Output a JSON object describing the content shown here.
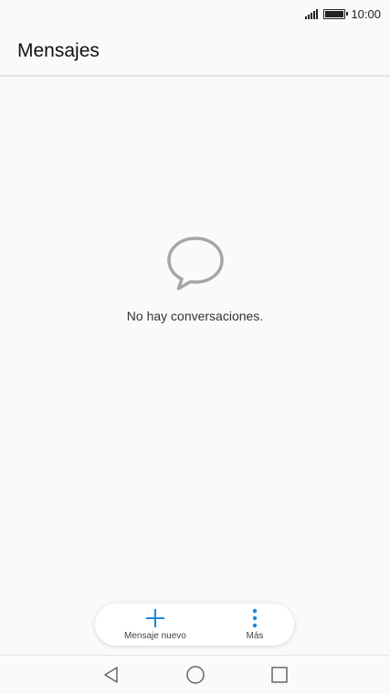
{
  "status_bar": {
    "time": "10:00",
    "signal_icon": "signal-icon",
    "battery_icon": "battery-icon"
  },
  "app_bar": {
    "title": "Mensajes"
  },
  "empty_state": {
    "icon": "chat-bubble-icon",
    "text": "No hay conversaciones."
  },
  "actions": {
    "new_message_label": "Mensaje nuevo",
    "more_label": "Más"
  },
  "nav_bar": {
    "back_icon": "back-triangle-icon",
    "home_icon": "home-circle-icon",
    "recents_icon": "recents-square-icon"
  },
  "colors": {
    "accent": "#1a87d9",
    "background": "#fafafa",
    "icon_gray": "#a6a6a6"
  }
}
